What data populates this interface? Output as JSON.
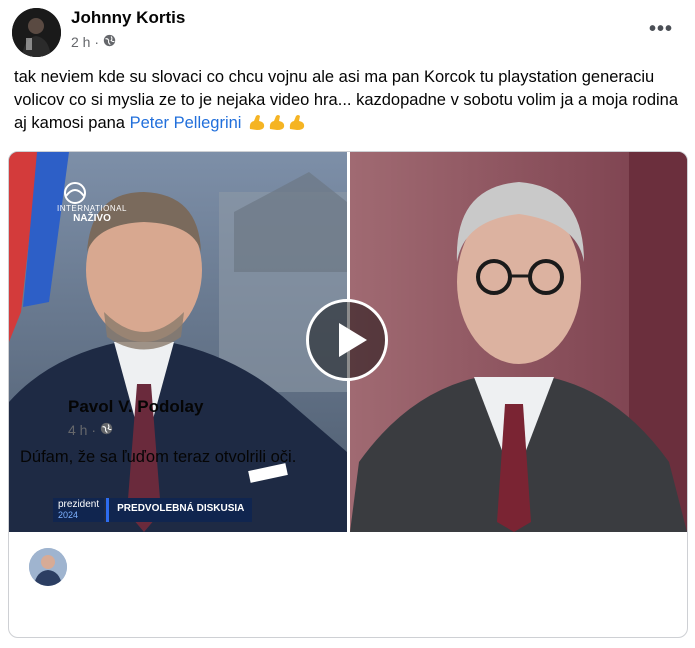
{
  "post": {
    "author": "Johnny Kortis",
    "time": "2 h ·",
    "privacy_icon": "globe-icon",
    "more_icon": "more-options-icon",
    "more_label": "•••",
    "text": "tak neviem kde su slovaci co chcu vojnu ale asi ma pan Korcok tu playstation generaciu volicov co si myslia ze to je nejaka video hra... kazdopadne v sobotu volim ja a moja rodina aj kamosi pana ",
    "mention": "Peter Pellegrini",
    "emoji": "flexed-biceps-icon x3",
    "mention_color": "#216fdb"
  },
  "video": {
    "broadcaster_label": "INTERNATIONAL",
    "live_label": "NAŽIVO",
    "brand_top": "prezident",
    "brand_year": "2024",
    "program_title": "PREDVOLEBNÁ DISKUSIA",
    "play_icon": "play-button-icon"
  },
  "shared": {
    "author": "Pavol V. Podolay",
    "time": "4 h ·",
    "privacy_icon": "globe-icon",
    "text": "Dúfam, že sa ľuďom teraz otvolrili oči."
  }
}
